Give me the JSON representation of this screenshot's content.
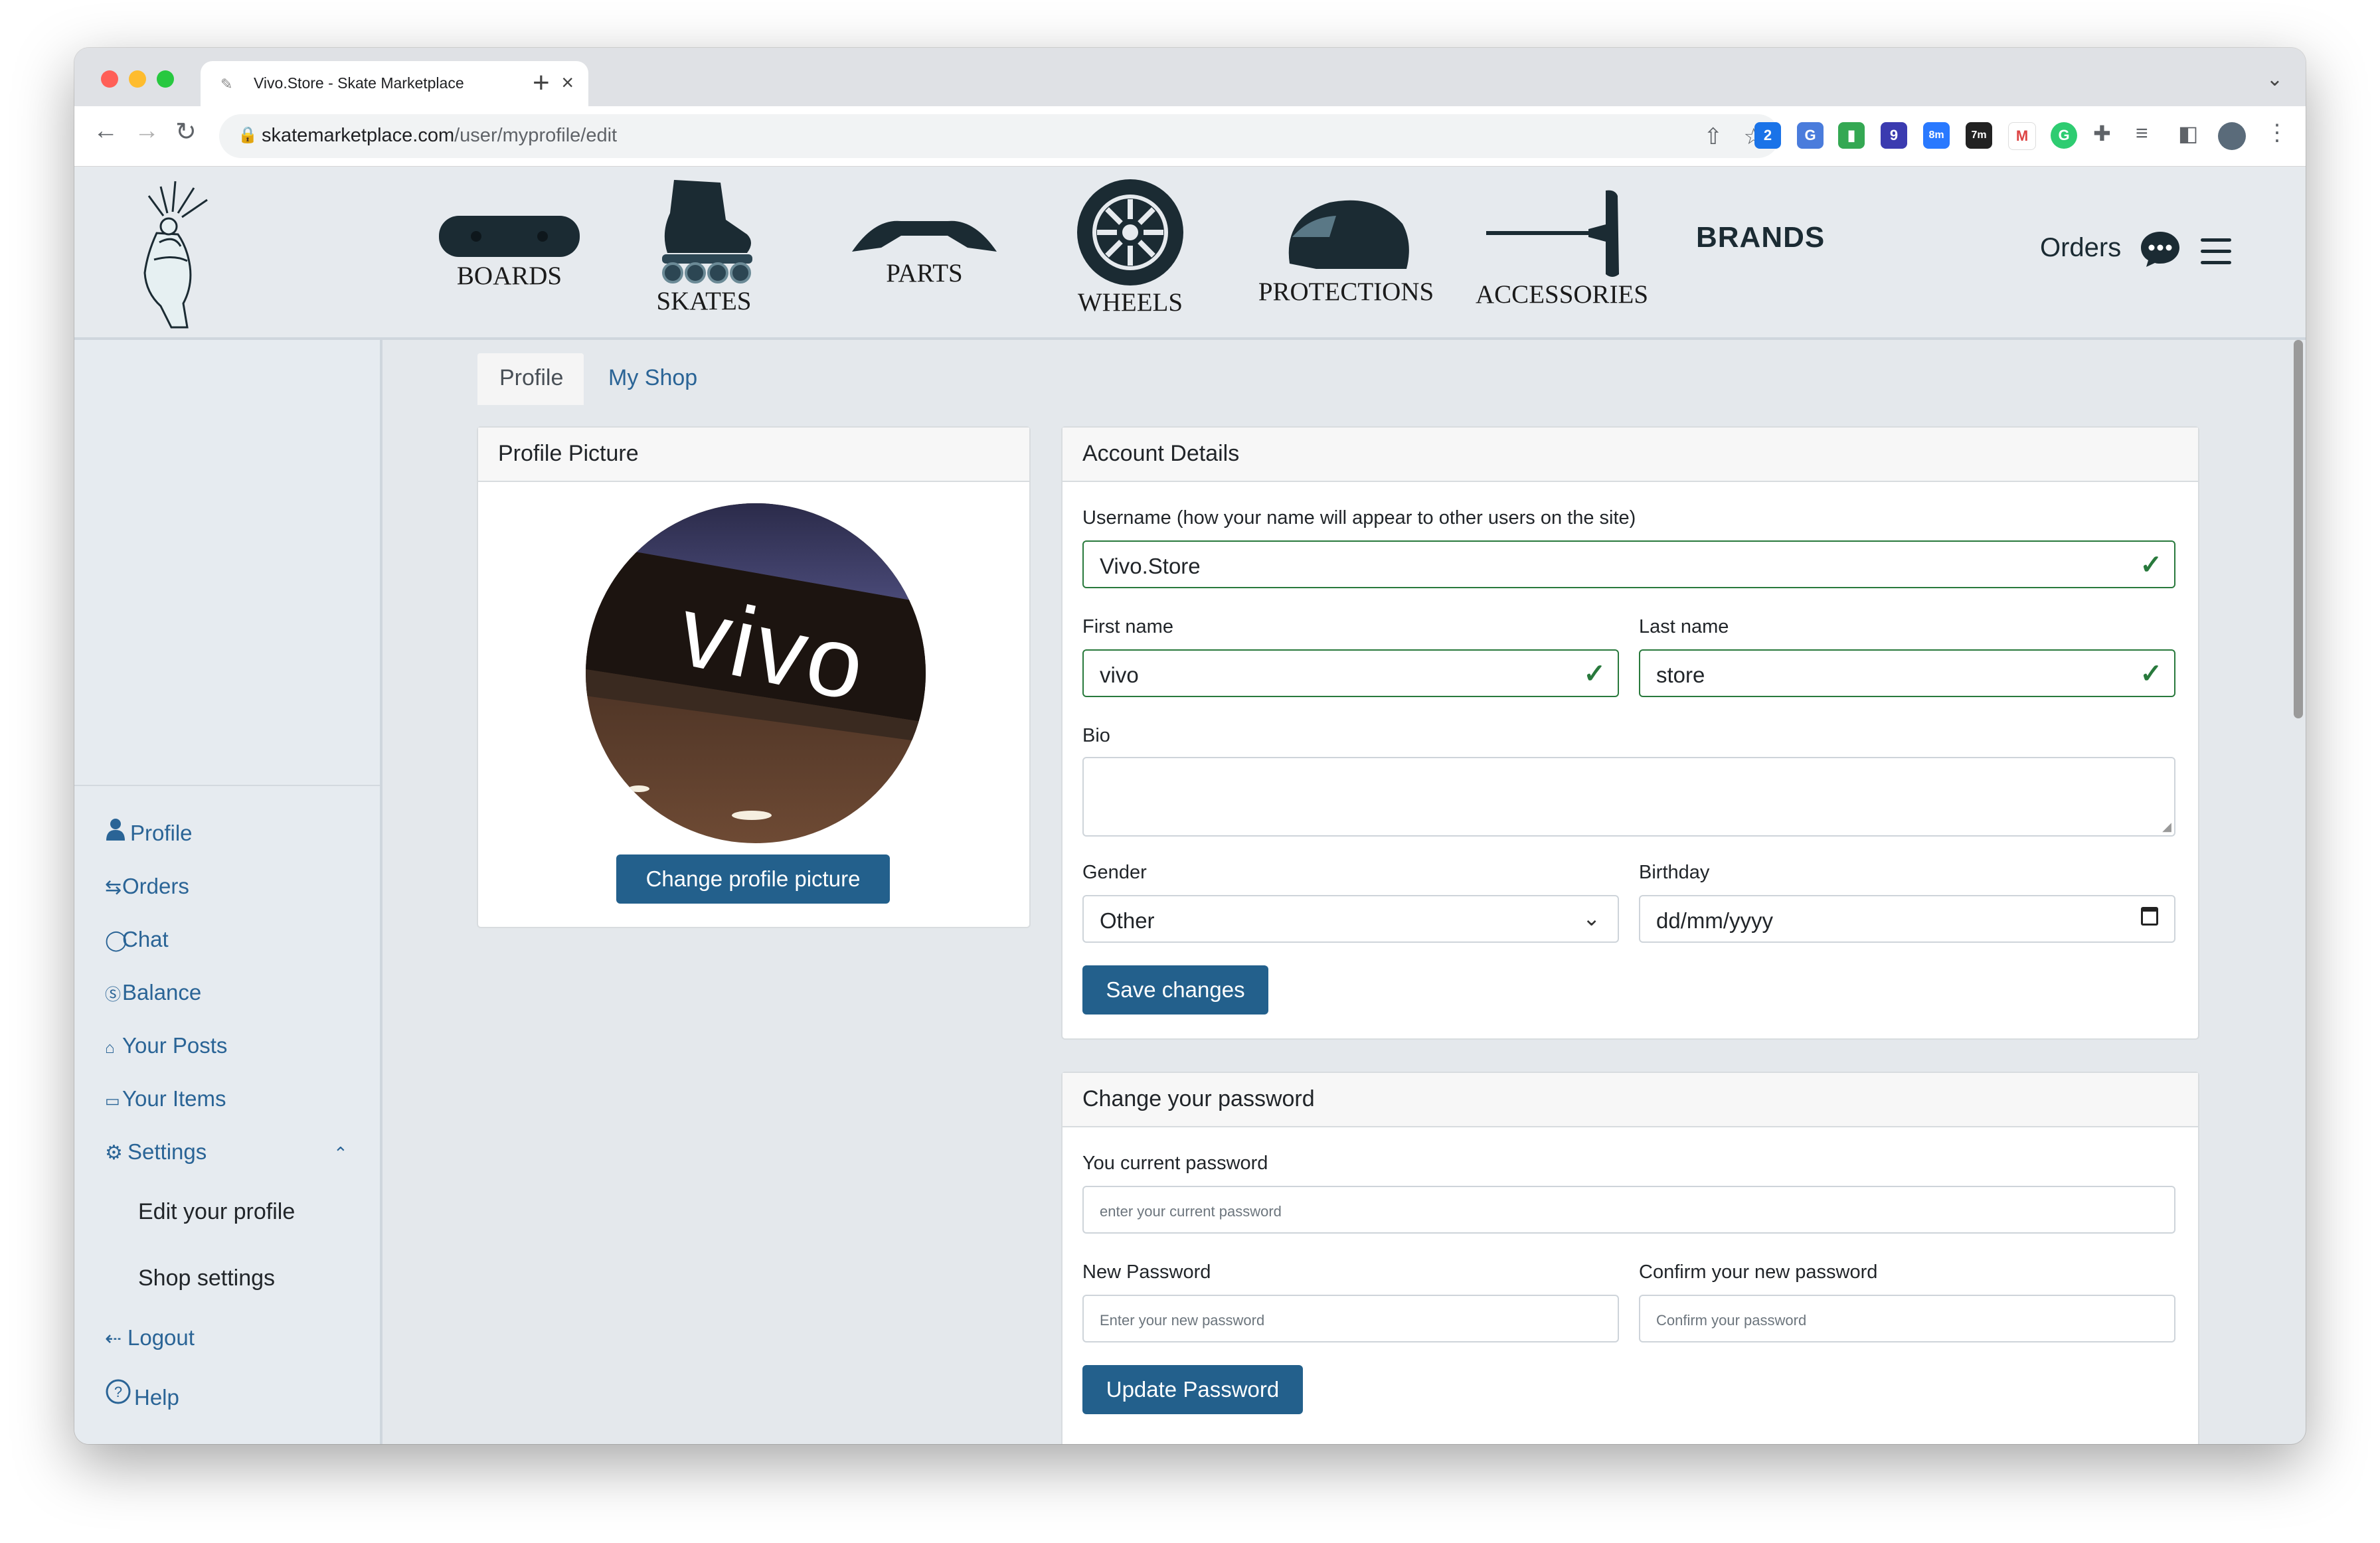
{
  "browser": {
    "tab_title": "Vivo.Store - Skate Marketplace",
    "url_host": "skatemarketplace.com",
    "url_path": "/user/myprofile/edit",
    "extension_badges": [
      "2",
      "9",
      "8m",
      "7m"
    ]
  },
  "header": {
    "categories": [
      "BOARDS",
      "SKATES",
      "PARTS",
      "WHEELS",
      "PROTECTIONS",
      "ACCESSORIES"
    ],
    "brands": "BRANDS",
    "orders": "Orders"
  },
  "sidebar": {
    "items": [
      {
        "label": "Profile",
        "icon": "person-icon"
      },
      {
        "label": "Orders",
        "icon": "swap-icon"
      },
      {
        "label": "Chat",
        "icon": "chat-icon"
      },
      {
        "label": "Balance",
        "icon": "dollar-icon"
      },
      {
        "label": "Your Posts",
        "icon": "shop-icon"
      },
      {
        "label": "Your Items",
        "icon": "box-icon"
      },
      {
        "label": "Settings",
        "icon": "gear-icon"
      }
    ],
    "settings_sub": [
      "Edit your profile",
      "Shop settings"
    ],
    "logout": "Logout",
    "help": "Help"
  },
  "tabs": [
    "Profile",
    "My Shop"
  ],
  "profile_picture": {
    "title": "Profile Picture",
    "avatar_text": "vivo",
    "button": "Change profile picture"
  },
  "account": {
    "title": "Account Details",
    "username_label": "Username (how your name will appear to other users on the site)",
    "username": "Vivo.Store",
    "first_name_label": "First name",
    "first_name": "vivo",
    "last_name_label": "Last name",
    "last_name": "store",
    "bio_label": "Bio",
    "gender_label": "Gender",
    "gender": "Other",
    "birthday_label": "Birthday",
    "birthday_placeholder": "dd/mm/yyyy",
    "save": "Save changes"
  },
  "password": {
    "title": "Change your password",
    "current_label": "You current password",
    "current_placeholder": "enter your current password",
    "new_label": "New Password",
    "new_placeholder": "Enter your new password",
    "confirm_label": "Confirm your new password",
    "confirm_placeholder": "Confirm your password",
    "button": "Update Password"
  },
  "colors": {
    "accent": "#23608c",
    "valid": "#28793c",
    "link": "#2a6496"
  }
}
